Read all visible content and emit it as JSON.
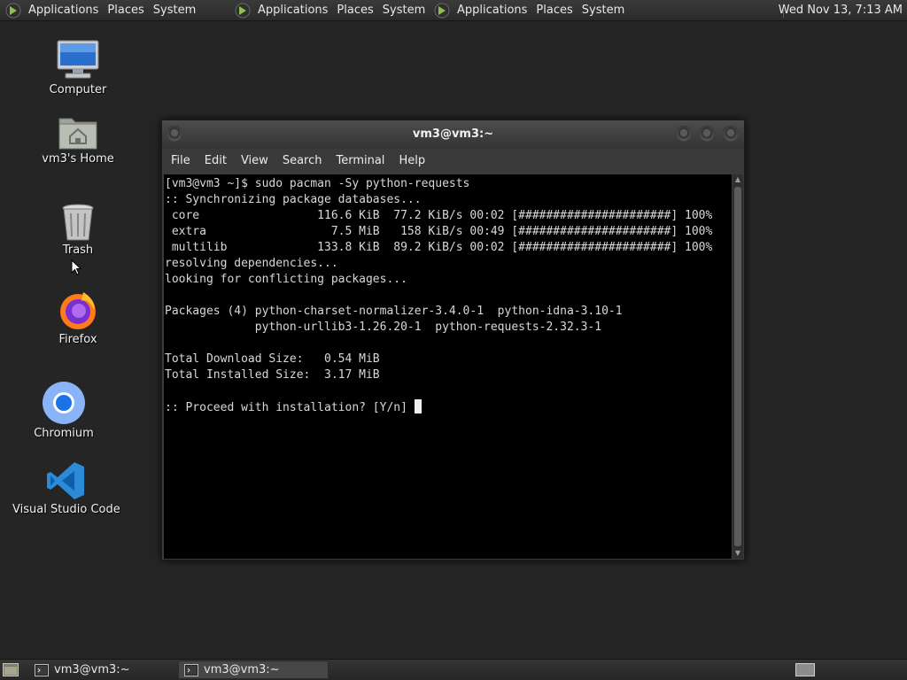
{
  "top_panel": {
    "menus": [
      {
        "applications": "Applications",
        "places": "Places",
        "system": "System"
      },
      {
        "applications": "Applications",
        "places": "Places",
        "system": "System"
      },
      {
        "applications": "Applications",
        "places": "Places",
        "system": "System"
      }
    ],
    "clock": "Wed Nov 13,  7:13 AM"
  },
  "desktop": {
    "icons": [
      {
        "label": "Computer",
        "icon": "computer-icon"
      },
      {
        "label": "vm3's Home",
        "icon": "home-folder-icon"
      },
      {
        "label": "Trash",
        "icon": "trash-icon"
      },
      {
        "label": "Firefox",
        "icon": "firefox-icon"
      },
      {
        "label": "Chromium",
        "icon": "chromium-icon"
      },
      {
        "label": "Visual Studio Code",
        "icon": "vscode-icon"
      }
    ]
  },
  "terminal_window": {
    "title": "vm3@vm3:~",
    "menu": [
      "File",
      "Edit",
      "View",
      "Search",
      "Terminal",
      "Help"
    ],
    "lines": [
      "[vm3@vm3 ~]$ sudo pacman -Sy python-requests",
      ":: Synchronizing package databases...",
      " core                 116.6 KiB  77.2 KiB/s 00:02 [######################] 100%",
      " extra                  7.5 MiB   158 KiB/s 00:49 [######################] 100%",
      " multilib             133.8 KiB  89.2 KiB/s 00:02 [######################] 100%",
      "resolving dependencies...",
      "looking for conflicting packages...",
      "",
      "Packages (4) python-charset-normalizer-3.4.0-1  python-idna-3.10-1",
      "             python-urllib3-1.26.20-1  python-requests-2.32.3-1",
      "",
      "Total Download Size:   0.54 MiB",
      "Total Installed Size:  3.17 MiB",
      ""
    ],
    "prompt": ":: Proceed with installation? [Y/n] "
  },
  "taskbar": {
    "tasks": [
      {
        "label": "vm3@vm3:~",
        "active": false
      },
      {
        "label": "vm3@vm3:~",
        "active": true
      }
    ]
  },
  "colors": {
    "desktop_bg": "#252525",
    "panel_bg": "#2f2f2f",
    "terminal_bg": "#000000",
    "terminal_fg": "#d8d8d8",
    "mate_logo": "#8fbf4f"
  }
}
